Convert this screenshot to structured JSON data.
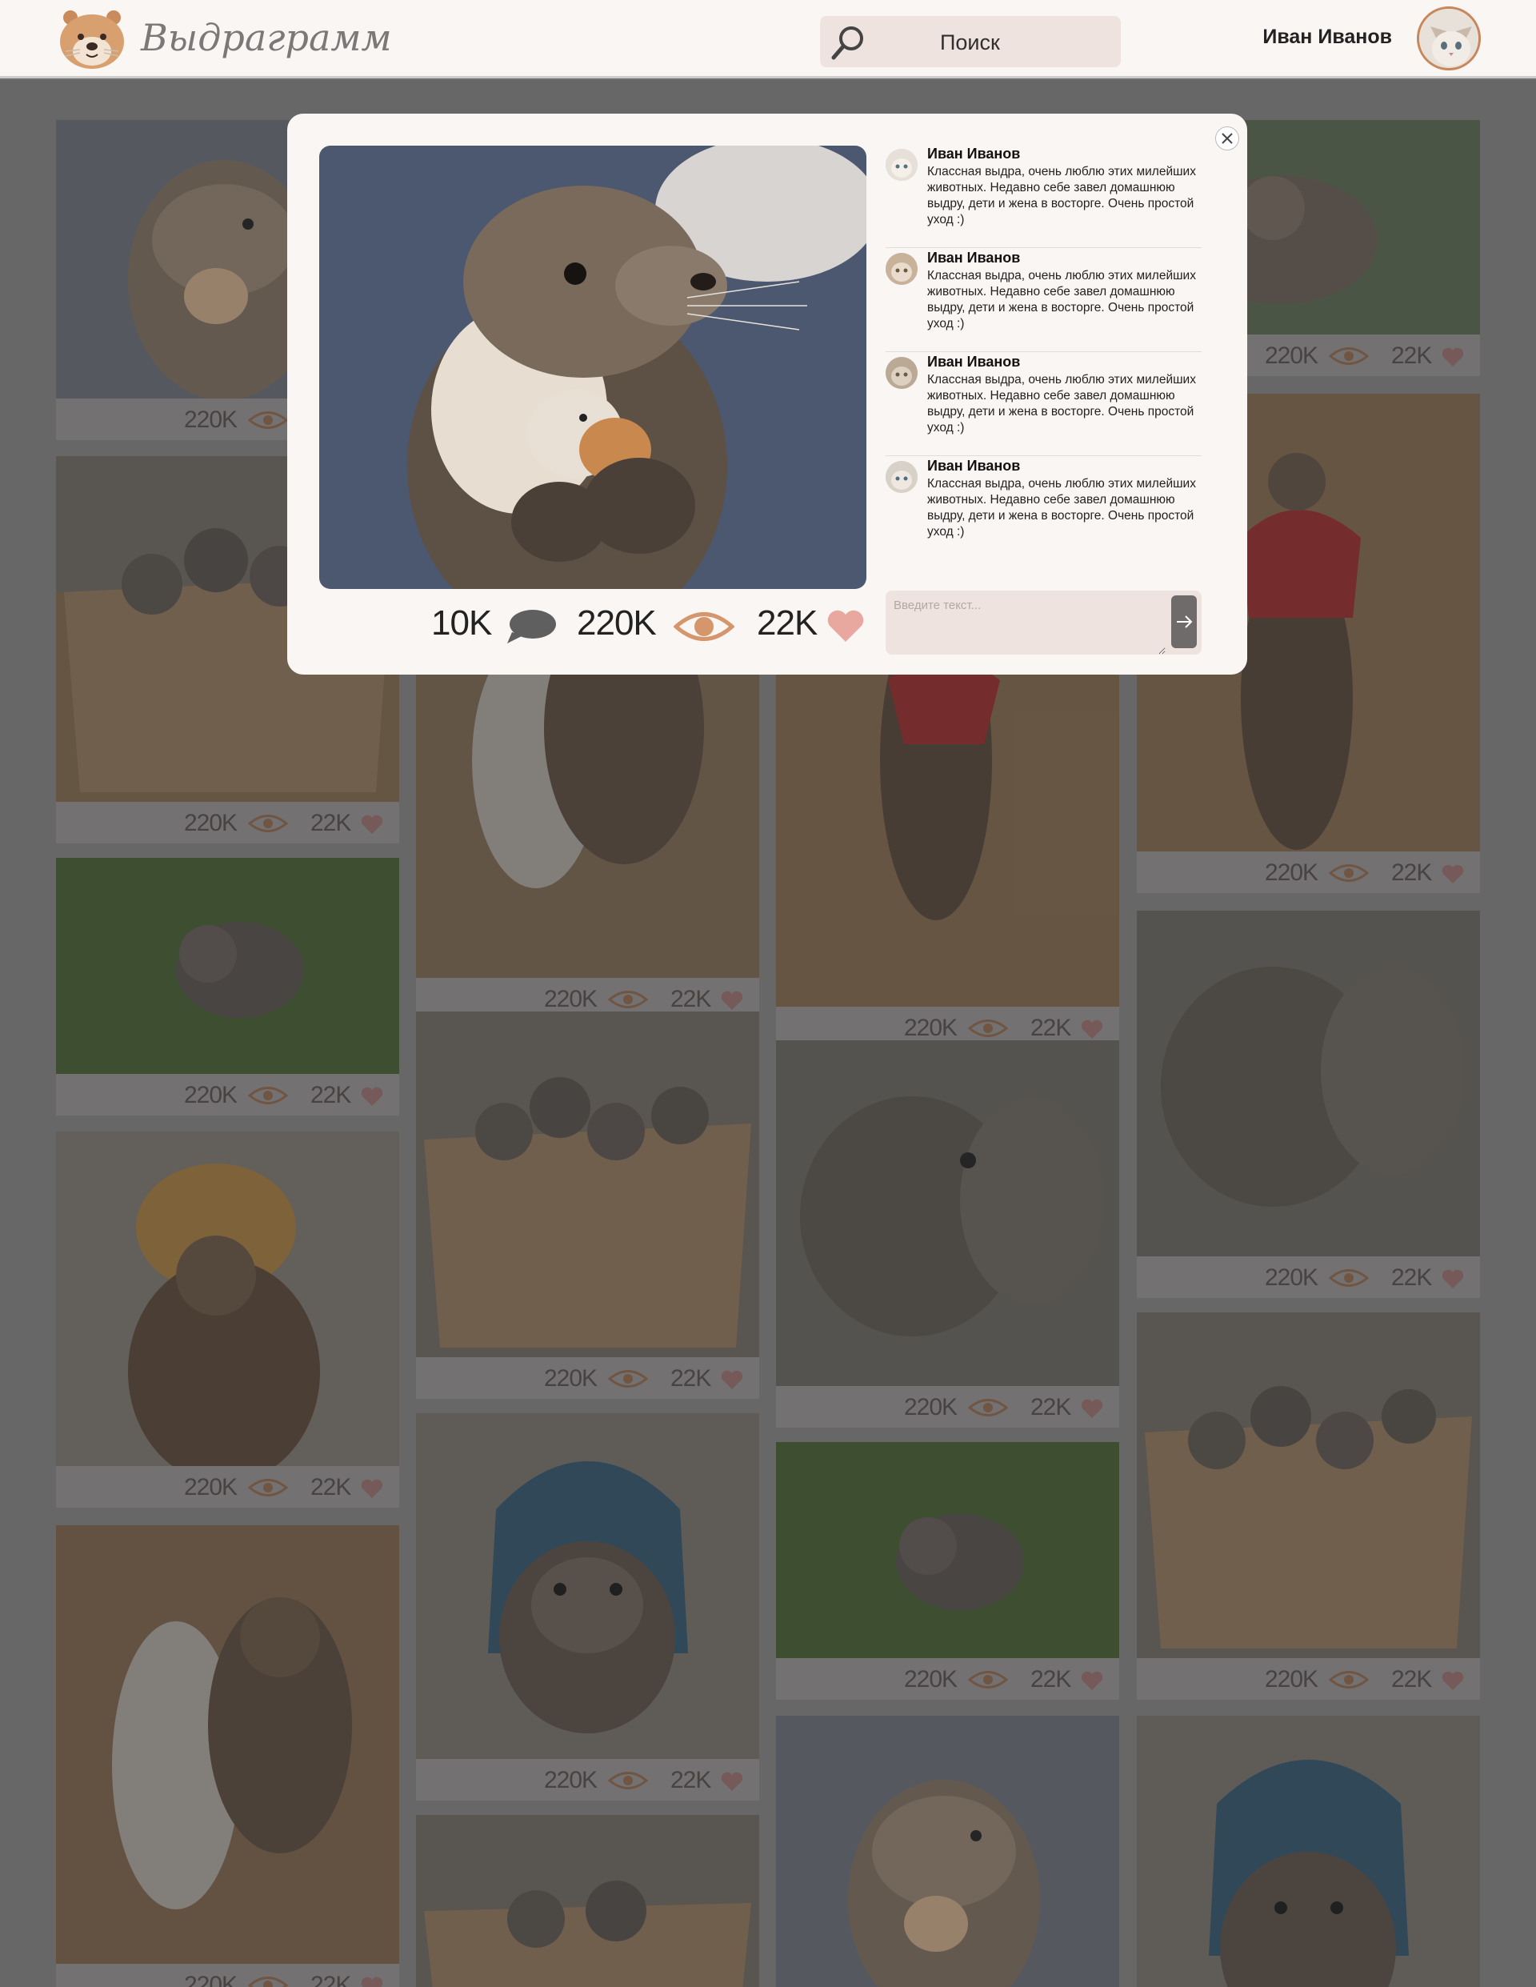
{
  "header": {
    "logo_text": "Выдраграмм",
    "search_placeholder": "Поиск",
    "user_name": "Иван Иванов"
  },
  "icons": {
    "logo": "otter-face-icon",
    "search": "search-icon",
    "views": "eye-icon",
    "likes": "heart-icon",
    "comments": "speech-bubble-icon",
    "close": "close-icon",
    "send": "arrow-right-icon"
  },
  "colors": {
    "accent": "#d4966a",
    "heart": "#e8a8a0",
    "panel": "#faf6f4",
    "field": "#efe3df"
  },
  "modal": {
    "comments_count": "10K",
    "views": "220K",
    "likes": "22K",
    "comment_placeholder": "Введите текст...",
    "comments": [
      {
        "author": "Иван Иванов",
        "text": "Классная выдра, очень люблю этих милейших животных. Недавно себе завел домашнюю выдру, дети и жена в восторге. Очень простой уход :)"
      },
      {
        "author": "Иван Иванов",
        "text": "Классная выдра, очень люблю этих милейших животных. Недавно себе завел домашнюю выдру, дети и жена в восторге. Очень простой уход :)"
      },
      {
        "author": "Иван Иванов",
        "text": "Классная выдра, очень люблю этих милейших животных. Недавно себе завел домашнюю выдру, дети и жена в восторге. Очень простой уход :)"
      },
      {
        "author": "Иван Иванов",
        "text": "Классная выдра, очень люблю этих милейших животных. Недавно себе завел домашнюю выдру, дети и жена в восторге. Очень простой уход :)"
      }
    ]
  },
  "feed": {
    "views": "220K",
    "likes": "22K"
  }
}
